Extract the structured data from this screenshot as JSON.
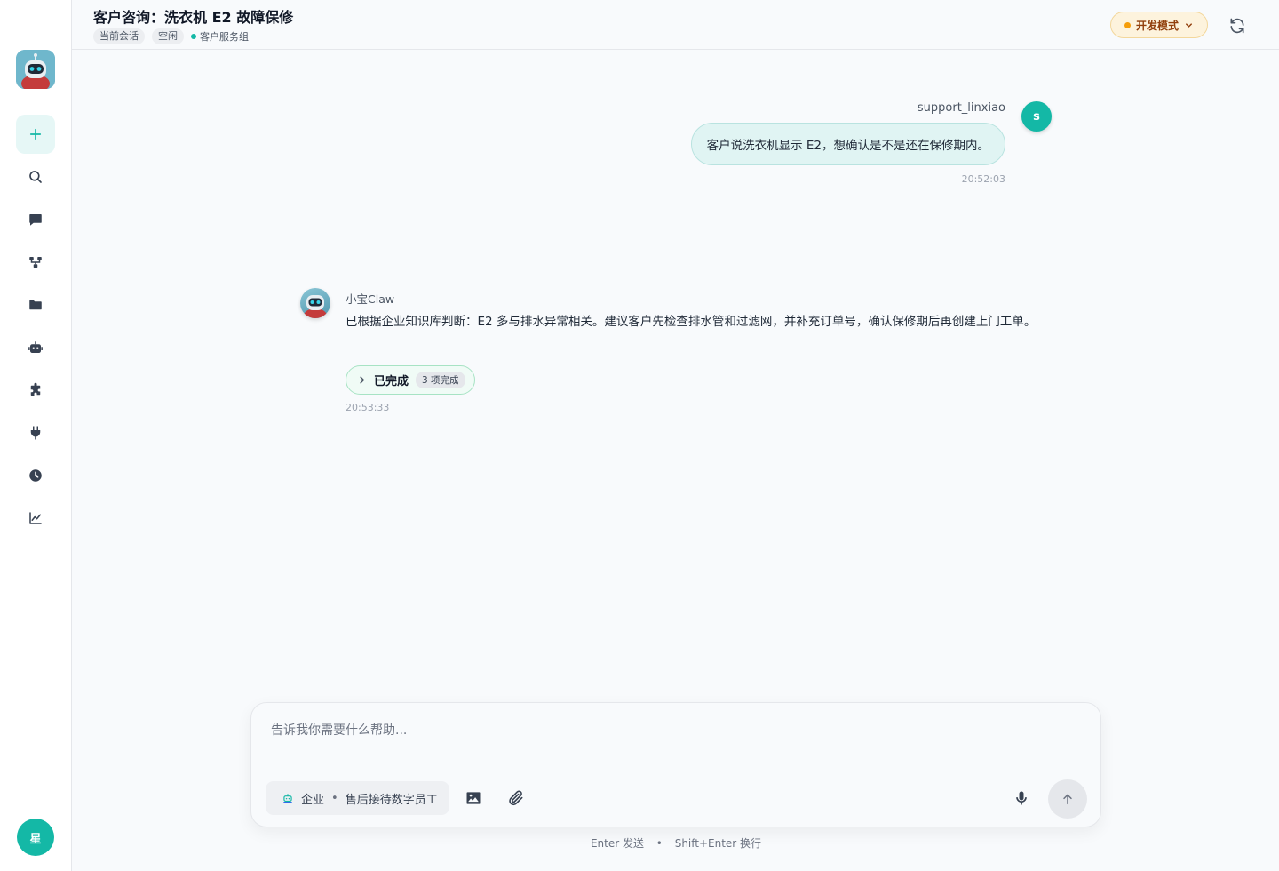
{
  "header": {
    "title": "客户咨询：洗衣机 E2 故障保修",
    "tags": [
      "当前会话",
      "空闲"
    ],
    "group": "客户服务组",
    "mode_label": "开发模式"
  },
  "sidebar": {
    "user_initial": "星",
    "items": [
      "plus-icon",
      "search-icon",
      "chat-icon",
      "workflow-icon",
      "folder-icon",
      "robot-icon",
      "puzzle-icon",
      "plug-icon",
      "clock-icon",
      "chart-icon"
    ]
  },
  "messages": [
    {
      "role": "user",
      "name": "support_linxiao",
      "avatar_initial": "s",
      "text": "客户说洗衣机显示 E2，想确认是不是还在保修期内。",
      "time": "20:52:03"
    },
    {
      "role": "assistant",
      "name": "小宝Claw",
      "text": "已根据企业知识库判断：E2 多与排水异常相关。建议客户先检查排水管和过滤网，并补充订单号，确认保修期后再创建上门工单。",
      "status_label": "已完成",
      "status_count": "3 项完成",
      "time": "20:53:33"
    }
  ],
  "composer": {
    "placeholder": "告诉我你需要什么帮助...",
    "agent_scope": "企业",
    "agent_name": "售后接待数字员工",
    "hint_send": "Enter 发送",
    "hint_newline": "Shift+Enter 换行"
  },
  "colors": {
    "accent": "#14b8a6",
    "mode_bg": "#fdf3dd",
    "user_bubble": "#e0f4f3"
  }
}
